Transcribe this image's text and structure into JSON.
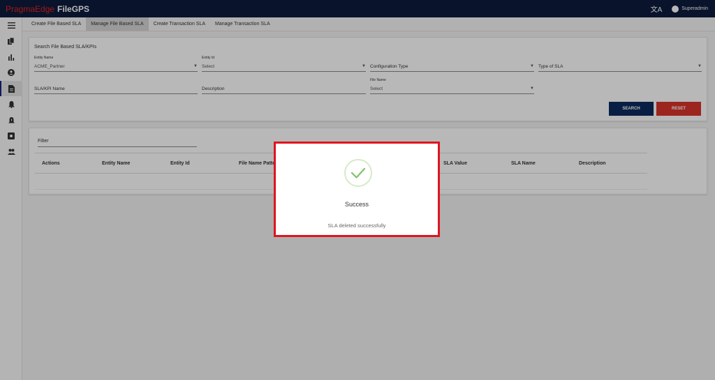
{
  "app": {
    "brand_primary": "PragmaEdge",
    "brand_secondary": "FileGPS",
    "user": "Superadmin"
  },
  "tabs": [
    {
      "label": "Create File Based SLA"
    },
    {
      "label": "Manage File Based SLA"
    },
    {
      "label": "Create Transaction SLA"
    },
    {
      "label": "Manage Transaction SLA"
    }
  ],
  "search": {
    "title": "Search File Based SLA/KPIs",
    "entity_name": {
      "label": "Entity Name",
      "value": "ACME_Partner"
    },
    "entity_id": {
      "label": "Entity Id",
      "value": "Select"
    },
    "configuration_type": {
      "value": "Configuration Type"
    },
    "type_of_sla": {
      "value": "Type of SLA"
    },
    "sla_kpi_name": {
      "value": "SLA/KPI Name"
    },
    "description": {
      "value": "Description"
    },
    "file_name": {
      "label": "File Name",
      "value": "Select"
    },
    "search_button": "SEARCH",
    "reset_button": "RESET"
  },
  "results": {
    "filter_placeholder": "Filter",
    "columns": [
      "Actions",
      "Entity Name",
      "Entity Id",
      "File Name Pattern",
      "SLA Value",
      "SLA Name",
      "Description"
    ]
  },
  "dialog": {
    "title": "Success",
    "message": "SLA deleted successfully"
  },
  "colors": {
    "topbar": "#0d1b3e",
    "brand_red": "#e2231a",
    "search_button": "#0d2a5e",
    "reset_button": "#d9342b",
    "dialog_border": "#e0141e",
    "check_green": "#7cc46a"
  }
}
